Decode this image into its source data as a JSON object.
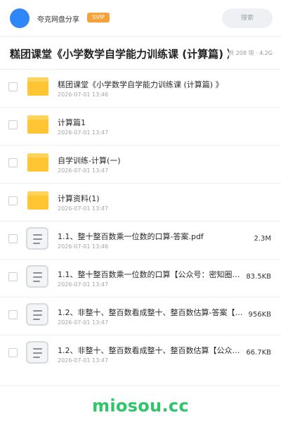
{
  "header": {
    "user_name": "夸克网盘分享",
    "badge": "SVIP",
    "search_placeholder": "搜索"
  },
  "folder_title": "糕团课堂《小学数学自学能力训练课 (计算篇) 》",
  "folder_meta": "共 208 项 · 4.2G",
  "items": [
    {
      "type": "folder",
      "name": "糕团课堂《小学数学自学能力训练课 (计算篇) 》",
      "date": "2026-07-01 13:46",
      "size": ""
    },
    {
      "type": "folder",
      "name": "计算篇1",
      "date": "2026-07-01 13:47",
      "size": ""
    },
    {
      "type": "folder",
      "name": "自学训练-计算(一)",
      "date": "2026-07-01 13:47",
      "size": ""
    },
    {
      "type": "folder",
      "name": "计算资料(1)",
      "date": "2026-07-01 13:47",
      "size": ""
    },
    {
      "type": "file",
      "name": "1.1、整十整百数乘一位数的口算-答案.pdf",
      "date": "2026-07-01 13:46",
      "size": "2.3M"
    },
    {
      "type": "file",
      "name": "1.1、整十整百数乘一位数的口算【公众号：密知圈】…",
      "date": "2026-07-01 13:47",
      "size": "83.5KB"
    },
    {
      "type": "file",
      "name": "1.2、非整十、整百数看成整十、整百数估算-答案【…",
      "date": "2026-07-01 13:47",
      "size": "956KB"
    },
    {
      "type": "file",
      "name": "1.2、非整十、整百数看成整十、整百数估算【公众号…",
      "date": "2026-07-01 13:47",
      "size": "66.7KB"
    }
  ],
  "watermark": "miosou.cc",
  "colors": {
    "avatar": "#2f86f6",
    "svip_badge": "#f6a23a",
    "folder": "#ffc533",
    "watermark": "#2fc66a"
  },
  "icons": {
    "folder": "folder-icon",
    "file": "document-icon"
  }
}
